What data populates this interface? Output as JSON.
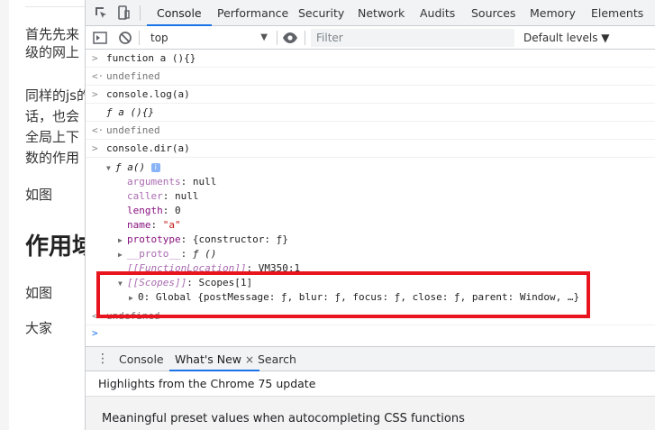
{
  "article": {
    "lines": [
      "首先先来",
      "级的网上",
      "同样的js的",
      "话，也会",
      "全局上下",
      "数的作用",
      "如图",
      "如图",
      "大家"
    ],
    "heading": "作用域"
  },
  "devtools": {
    "tabs": [
      "Console",
      "Performance",
      "Security",
      "Network",
      "Audits",
      "Sources",
      "Memory",
      "Elements"
    ],
    "active_tab": "Console",
    "filterbar": {
      "context": "top",
      "filter_placeholder": "Filter",
      "levels": "Default levels ▼"
    },
    "console": {
      "lines": [
        {
          "type": "input",
          "glyph": ">",
          "text": "function a (){}"
        },
        {
          "type": "result",
          "glyph": "<·",
          "text": "undefined"
        },
        {
          "type": "input",
          "glyph": ">",
          "text": "console.log(a)"
        },
        {
          "type": "log",
          "glyph": "",
          "text": "ƒ a (){}"
        },
        {
          "type": "result",
          "glyph": "<·",
          "text": "undefined"
        },
        {
          "type": "input",
          "glyph": ">",
          "text": "console.dir(a)"
        }
      ],
      "tree": {
        "root": "ƒ a()",
        "props": [
          {
            "key": "arguments",
            "value": "null"
          },
          {
            "key": "caller",
            "value": "null"
          },
          {
            "key": "length",
            "value": "0"
          },
          {
            "key": "name",
            "value": "\"a\""
          },
          {
            "key": "prototype",
            "value": "{constructor: ƒ}"
          },
          {
            "key": "__proto__",
            "value": "ƒ ()"
          },
          {
            "key": "[[FunctionLocation]]",
            "value": "VM350:1"
          },
          {
            "key": "[[Scopes]]",
            "value": "Scopes[1]"
          }
        ],
        "scope_item": "0: Global {postMessage: ƒ, blur: ƒ, focus: ƒ, close: ƒ, parent: Window, …}"
      },
      "tail": {
        "glyph": "<·",
        "text": "undefined"
      },
      "prompt": ">"
    },
    "drawer": {
      "tabs": [
        "Console",
        "What's New",
        "Search"
      ],
      "active_tab": "What's New",
      "close_glyph": "×",
      "header": "Highlights from the Chrome 75 update",
      "item": "Meaningful preset values when autocompleting CSS functions"
    }
  },
  "colors": {
    "highlight": "#e8141e",
    "accent": "#1a73e8",
    "key_purple": "#881280",
    "string_red": "#c41a16"
  }
}
